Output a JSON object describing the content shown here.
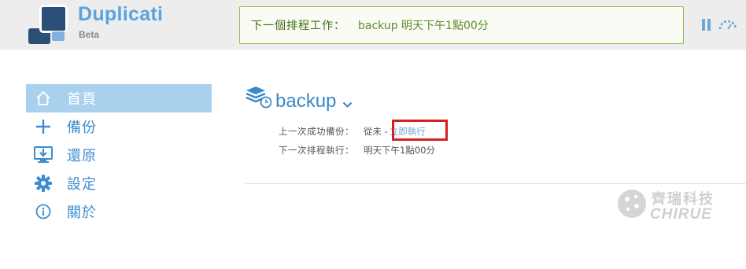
{
  "app": {
    "name": "Duplicati",
    "subtitle": "Beta"
  },
  "schedule": {
    "label": "下一個排程工作：",
    "value": "backup 明天下午1點00分"
  },
  "toolbar": {
    "pause_icon": "pause-icon",
    "throttle_icon": "throttle-gauge-icon"
  },
  "sidebar": {
    "items": [
      {
        "label": "首頁",
        "icon": "home-icon",
        "active": true
      },
      {
        "label": "備份",
        "icon": "plus-icon",
        "active": false
      },
      {
        "label": "還原",
        "icon": "restore-icon",
        "active": false
      },
      {
        "label": "設定",
        "icon": "gear-icon",
        "active": false
      },
      {
        "label": "關於",
        "icon": "info-icon",
        "active": false
      }
    ]
  },
  "backup": {
    "name": "backup",
    "last_success_label": "上一次成功備份：",
    "last_success_value": "從未 -",
    "run_now_link": "立即執行",
    "next_run_label": "下一次排程執行：",
    "next_run_value": "明天下午1點00分"
  },
  "watermark": {
    "cn": "齊瑞科技",
    "en": "CHIRUE"
  },
  "colors": {
    "accent": "#3d8ccf",
    "active_bg": "#a9d1ee",
    "schedule_border": "#8dbb56",
    "schedule_text": "#4b7e1d",
    "highlight": "#d42020"
  }
}
